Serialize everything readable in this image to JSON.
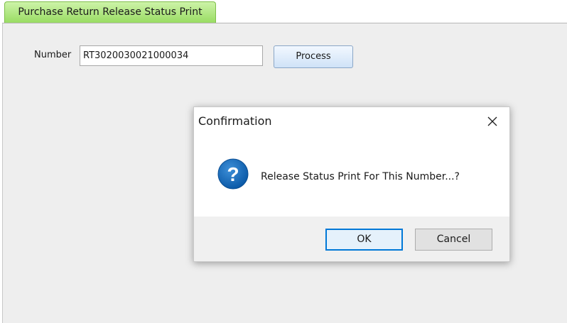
{
  "tab": {
    "label": "Purchase Return Release Status Print",
    "color": "#99dc63"
  },
  "form": {
    "number_label": "Number",
    "number_value": "RT302003002100003 4",
    "process_label": "Process"
  },
  "dialog": {
    "title": "Confirmation",
    "icon": "question-icon",
    "message": "Release Status Print For This Number...?",
    "ok_label": "OK",
    "cancel_label": "Cancel",
    "accent": "#0078d7"
  }
}
